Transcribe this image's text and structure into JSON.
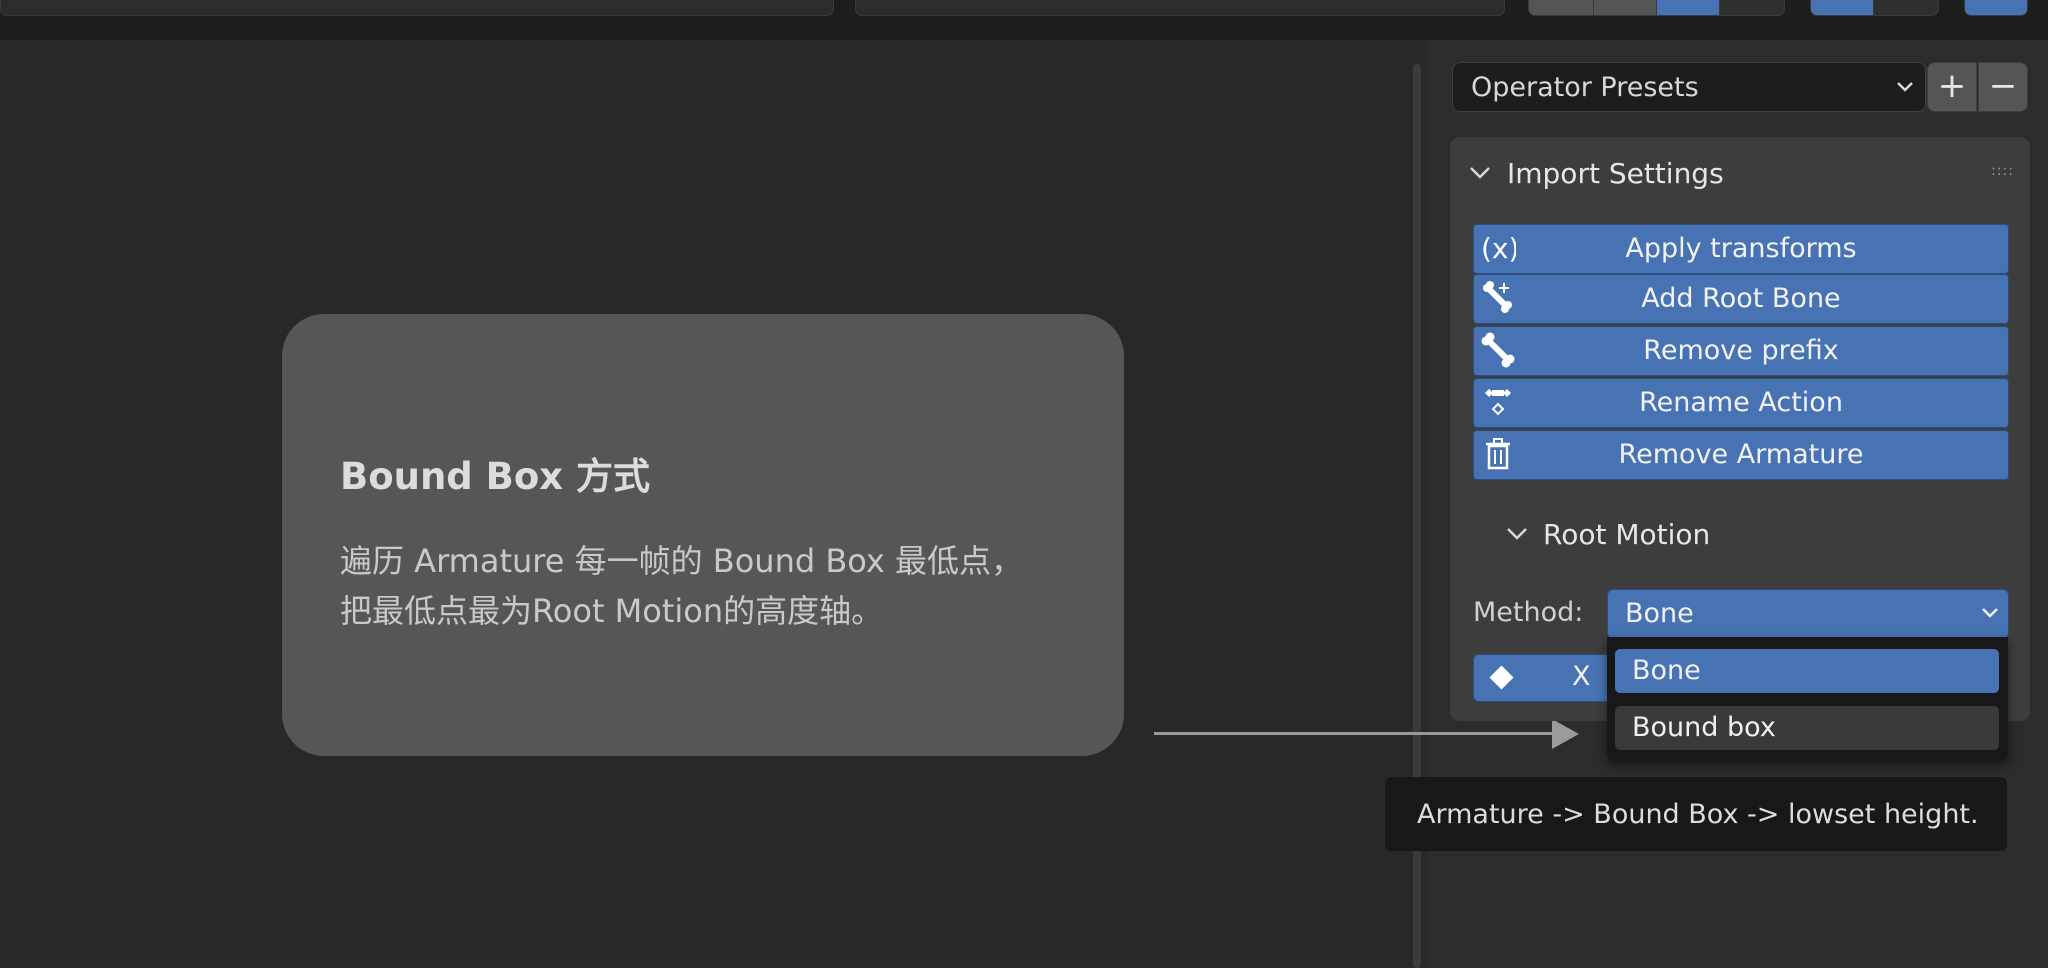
{
  "card": {
    "title": "Bound Box 方式",
    "line1": "遍历 Armature 每一帧的 Bound Box 最低点，",
    "line2": "把最低点最为Root Motion的高度轴。"
  },
  "presets": {
    "label": "Operator Presets",
    "add": "+",
    "remove": "−"
  },
  "panel": {
    "title": "Import Settings",
    "grip": "::::"
  },
  "operators": [
    {
      "label": "Apply transforms",
      "icon": "driver-variable-icon"
    },
    {
      "label": "Add Root Bone",
      "icon": "bone-add-icon"
    },
    {
      "label": "Remove prefix",
      "icon": "bone-icon"
    },
    {
      "label": "Rename Action",
      "icon": "action-keyframes-icon"
    },
    {
      "label": "Remove Armature",
      "icon": "trash-icon"
    }
  ],
  "root_motion": {
    "title": "Root Motion",
    "method_label": "Method:",
    "method_value": "Bone",
    "axis_label": "X"
  },
  "dropdown": {
    "options": [
      "Bone",
      "Bound box"
    ],
    "selected": "Bone"
  },
  "tooltip": {
    "text": "Armature -> Bound Box -> lowset height."
  },
  "colors": {
    "accent": "#4772b3",
    "panel": "#3d3d3d",
    "background": "#282828",
    "card": "#565656"
  }
}
